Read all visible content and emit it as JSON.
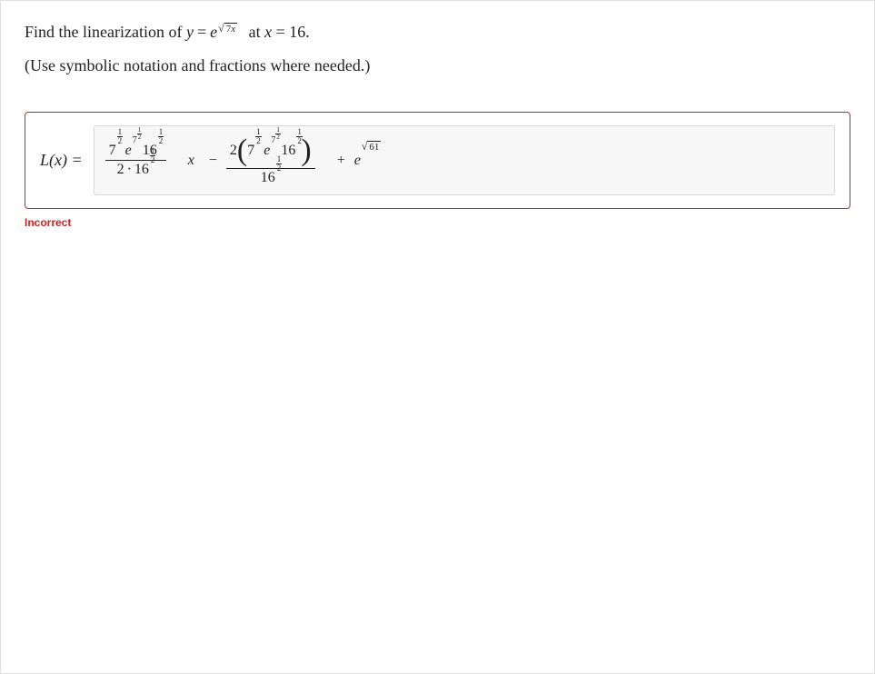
{
  "question": {
    "prefix": "Find the linearization of ",
    "eq_lhs": "y",
    "equals": " = ",
    "e": "e",
    "sqrt_inner_a": "7",
    "sqrt_inner_b": "x",
    "at_text": " at ",
    "x_var": "x",
    "at_val": " = 16."
  },
  "hint": "(Use symbolic notation and fractions where needed.)",
  "label_L": "L",
  "label_x": "x",
  "label_eq": " =",
  "half_num": "1",
  "half_den": "2",
  "seven": "7",
  "sixteen": "16",
  "two": "2",
  "dot": "·",
  "e": "e",
  "x": "x",
  "minus": "−",
  "plus": "+",
  "sqrt61": "61",
  "feedback": "Incorrect"
}
